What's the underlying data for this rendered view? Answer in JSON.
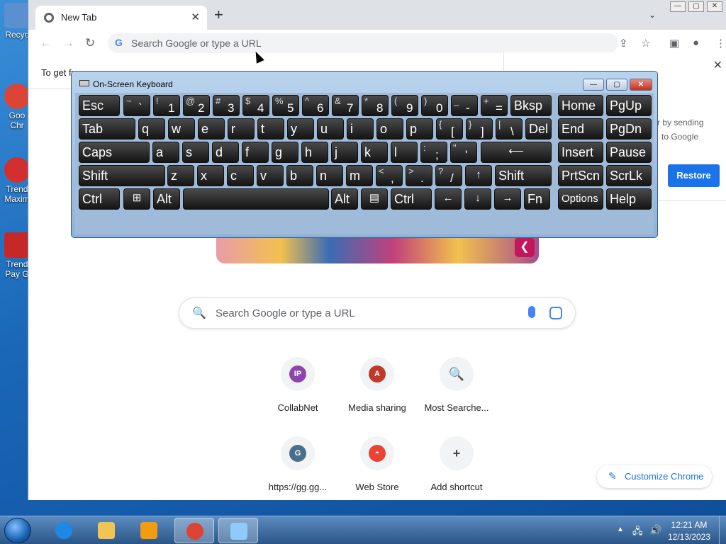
{
  "desktop": {
    "icons": [
      {
        "label": "Recyc",
        "color": "#5a8fd0"
      },
      {
        "label": "Goo Chr",
        "color": "#db4437"
      },
      {
        "label": "Trend Maxim",
        "color": "#d32f2f"
      },
      {
        "label": "Trend Pay G",
        "color": "#c62828"
      }
    ]
  },
  "chrome": {
    "tab_title": "New Tab",
    "tab_close": "✕",
    "new_tab": "+",
    "tab_dropdown": "⌄",
    "window_buttons": [
      "—",
      "▢",
      "✕"
    ],
    "back": "←",
    "forward": "→",
    "reload": "↻",
    "omnibox_g": "G",
    "omnibox_placeholder": "Search Google or type a URL",
    "share_icon": "⇪",
    "star_icon": "☆",
    "sidepanel_icon": "▣",
    "profile_icon": "●",
    "menu_icon": "⋮",
    "infobar_text": "To get fu",
    "restore": {
      "close": "✕",
      "line1": "r by sending",
      "line2": "to Google",
      "button": "Restore"
    },
    "doodle_share": "❮",
    "ntp_search_placeholder": "Search Google or type a URL",
    "ntp_search_icon": "🔍",
    "shortcuts": [
      {
        "label": "CollabNet",
        "glyph": "IP",
        "color": "#8e44ad"
      },
      {
        "label": "Media sharing",
        "glyph": "A",
        "color": "#c0392b"
      },
      {
        "label": "Most Searche...",
        "glyph": "🔍",
        "color": "#f1f3f4"
      },
      {
        "label": "https://gg.gg...",
        "glyph": "G",
        "color": "#4a6f8a"
      },
      {
        "label": "Web Store",
        "glyph": "◓",
        "color": "#ea4335"
      },
      {
        "label": "Add shortcut",
        "glyph": "+",
        "color": "#f1f3f4"
      }
    ],
    "customize_label": "Customize Chrome",
    "customize_icon": "✎"
  },
  "osk": {
    "title": "On-Screen Keyboard",
    "buttons": [
      "—",
      "▢",
      "✕"
    ],
    "rows": [
      [
        {
          "main": "Esc"
        },
        {
          "shift": "~",
          "primary": "`"
        },
        {
          "shift": "!",
          "primary": "1"
        },
        {
          "shift": "@",
          "primary": "2"
        },
        {
          "shift": "#",
          "primary": "3"
        },
        {
          "shift": "$",
          "primary": "4"
        },
        {
          "shift": "%",
          "primary": "5"
        },
        {
          "shift": "^",
          "primary": "6"
        },
        {
          "shift": "&",
          "primary": "7"
        },
        {
          "shift": "*",
          "primary": "8"
        },
        {
          "shift": "(",
          "primary": "9"
        },
        {
          "shift": ")",
          "primary": "0"
        },
        {
          "shift": "_",
          "primary": "-"
        },
        {
          "shift": "+",
          "primary": "="
        },
        {
          "main": "Bksp"
        },
        {
          "main": "Home"
        },
        {
          "main": "PgUp"
        }
      ],
      [
        {
          "main": "Tab"
        },
        {
          "main": "q"
        },
        {
          "main": "w"
        },
        {
          "main": "e"
        },
        {
          "main": "r"
        },
        {
          "main": "t"
        },
        {
          "main": "y"
        },
        {
          "main": "u"
        },
        {
          "main": "i"
        },
        {
          "main": "o"
        },
        {
          "main": "p"
        },
        {
          "shift": "{",
          "primary": "["
        },
        {
          "shift": "}",
          "primary": "]"
        },
        {
          "shift": "|",
          "primary": "\\"
        },
        {
          "main": "Del"
        },
        {
          "main": "End"
        },
        {
          "main": "PgDn"
        }
      ],
      [
        {
          "main": "Caps"
        },
        {
          "main": "a"
        },
        {
          "main": "s"
        },
        {
          "main": "d"
        },
        {
          "main": "f"
        },
        {
          "main": "g"
        },
        {
          "main": "h"
        },
        {
          "main": "j"
        },
        {
          "main": "k"
        },
        {
          "main": "l"
        },
        {
          "shift": ":",
          "primary": ";"
        },
        {
          "shift": "\"",
          "primary": "'"
        },
        {
          "center": "⟵"
        },
        {
          "main": "Insert"
        },
        {
          "main": "Pause"
        }
      ],
      [
        {
          "main": "Shift"
        },
        {
          "main": "z"
        },
        {
          "main": "x"
        },
        {
          "main": "c"
        },
        {
          "main": "v"
        },
        {
          "main": "b"
        },
        {
          "main": "n"
        },
        {
          "main": "m"
        },
        {
          "shift": "<",
          "primary": ","
        },
        {
          "shift": ">",
          "primary": "."
        },
        {
          "shift": "?",
          "primary": "/"
        },
        {
          "center": "↑"
        },
        {
          "main": "Shift"
        },
        {
          "main": "PrtScn"
        },
        {
          "main": "ScrLk"
        }
      ],
      [
        {
          "main": "Ctrl"
        },
        {
          "center": "⊞"
        },
        {
          "main": "Alt"
        },
        {
          "main": ""
        },
        {
          "main": "Alt"
        },
        {
          "center": "▤"
        },
        {
          "main": "Ctrl"
        },
        {
          "center": "←"
        },
        {
          "center": "↓"
        },
        {
          "center": "→"
        },
        {
          "main": "Fn"
        },
        {
          "main": "Options"
        },
        {
          "main": "Help"
        }
      ]
    ]
  },
  "taskbar": {
    "apps": [
      {
        "name": "ie-taskbar-icon",
        "color": "#1e88e5"
      },
      {
        "name": "explorer-taskbar-icon",
        "color": "#f1c453"
      },
      {
        "name": "media-player-taskbar-icon",
        "color": "#f39c12"
      },
      {
        "name": "chrome-taskbar-icon",
        "color": "#db4437"
      },
      {
        "name": "osk-taskbar-icon",
        "color": "#90caf9"
      }
    ],
    "tray_arrow": "▲",
    "network_icon": "🖧",
    "volume_icon": "🔊",
    "time": "12:21 AM",
    "date": "12/13/2023"
  }
}
